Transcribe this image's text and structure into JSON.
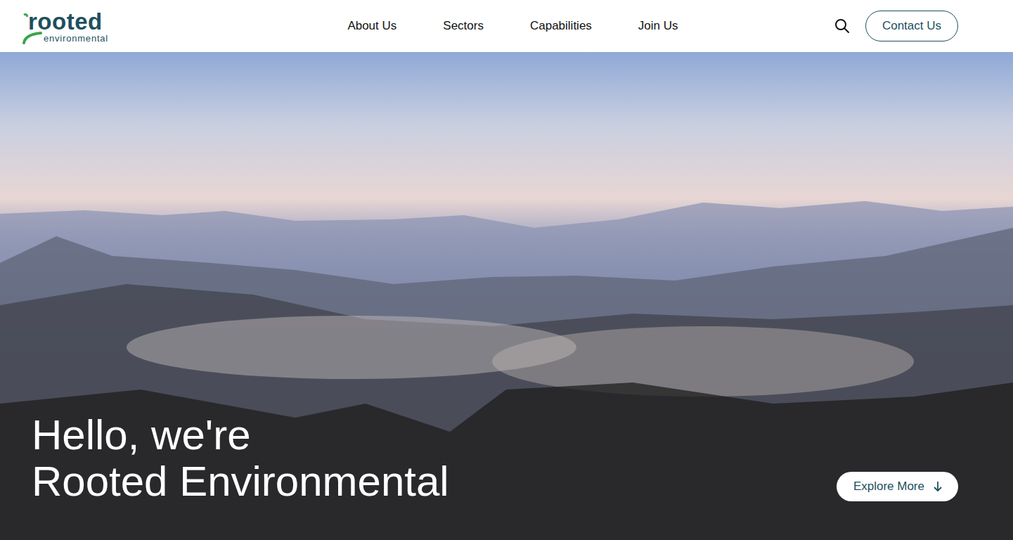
{
  "logo": {
    "word": "rooted",
    "sub": "environmental"
  },
  "nav": [
    "About Us",
    "Sectors",
    "Capabilities",
    "Join Us"
  ],
  "contact_button": "Contact Us",
  "hero": {
    "title_lines": [
      "Hello, we're",
      "Rooted Environmental"
    ],
    "button": "Explore More"
  }
}
